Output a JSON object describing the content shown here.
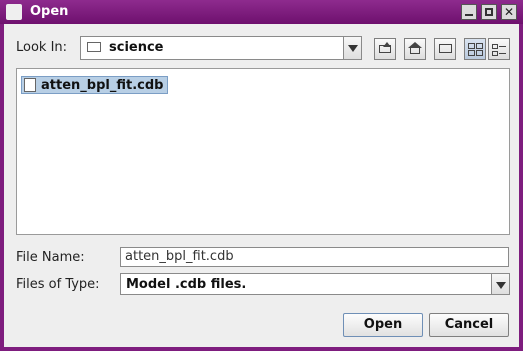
{
  "window": {
    "title": "Open"
  },
  "look_in": {
    "label": "Look In:",
    "value": "science"
  },
  "toolbar": {
    "icons": [
      "up-folder-icon",
      "home-icon",
      "new-folder-icon",
      "list-view-icon",
      "details-view-icon"
    ]
  },
  "files": [
    {
      "name": "atten_bpl_fit.cdb",
      "selected": true
    }
  ],
  "file_name": {
    "label": "File Name:",
    "value": "atten_bpl_fit.cdb"
  },
  "files_of_type": {
    "label": "Files of Type:",
    "value": "Model .cdb files."
  },
  "buttons": {
    "open": "Open",
    "cancel": "Cancel"
  },
  "colors": {
    "titlebar": "#7e1d7e",
    "selection": "#b8cfe5"
  }
}
